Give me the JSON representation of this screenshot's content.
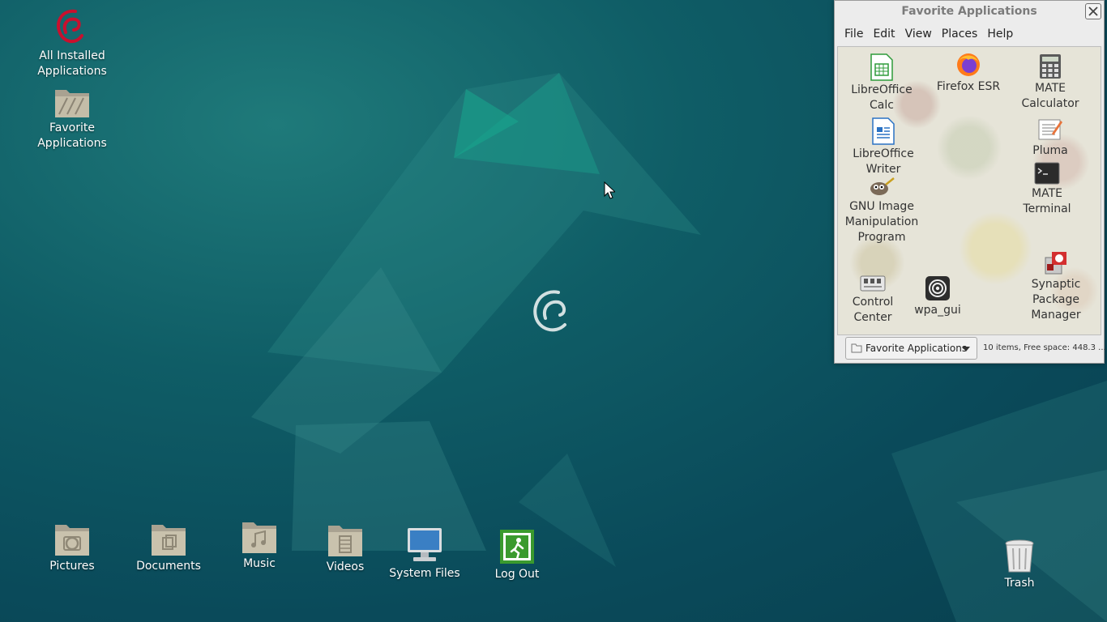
{
  "desktop": {
    "icons": [
      {
        "label": "All Installed\nApplications",
        "icon": "debian-swirl-icon"
      },
      {
        "label": "Favorite\nApplications",
        "icon": "folder-icon"
      },
      {
        "label": "Pictures",
        "icon": "pictures-folder-icon"
      },
      {
        "label": "Documents",
        "icon": "documents-folder-icon"
      },
      {
        "label": "Music",
        "icon": "music-folder-icon"
      },
      {
        "label": "Videos",
        "icon": "videos-folder-icon"
      },
      {
        "label": "System Files",
        "icon": "computer-icon"
      },
      {
        "label": "Log Out",
        "icon": "logout-icon"
      },
      {
        "label": "Trash",
        "icon": "trash-icon"
      }
    ]
  },
  "window": {
    "title": "Favorite Applications",
    "menu": [
      "File",
      "Edit",
      "View",
      "Places",
      "Help"
    ],
    "apps": [
      {
        "label": "LibreOffice\nCalc",
        "icon": "libreoffice-calc-icon"
      },
      {
        "label": "Firefox ESR",
        "icon": "firefox-icon"
      },
      {
        "label": "MATE\nCalculator",
        "icon": "calculator-icon"
      },
      {
        "label": "LibreOffice\nWriter",
        "icon": "libreoffice-writer-icon"
      },
      {
        "label": "Pluma",
        "icon": "pluma-editor-icon"
      },
      {
        "label": "MATE\nTerminal",
        "icon": "terminal-icon"
      },
      {
        "label": "GNU Image\nManipulation\nProgram",
        "icon": "gimp-icon"
      },
      {
        "label": "Control\nCenter",
        "icon": "control-center-icon"
      },
      {
        "label": "wpa_gui",
        "icon": "wifi-icon"
      },
      {
        "label": "Synaptic\nPackage\nManager",
        "icon": "synaptic-icon"
      }
    ],
    "location_button": "Favorite Applications",
    "status": "10 items, Free space: 448.3 ..."
  },
  "colors": {
    "desktop": "#0f5d66",
    "window_bg": "#ebebeb"
  }
}
